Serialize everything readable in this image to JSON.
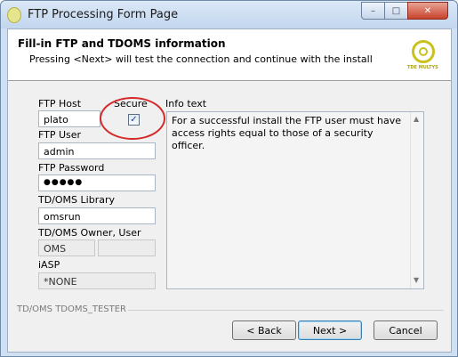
{
  "window": {
    "title": "FTP Processing Form Page",
    "min_symbol": "–",
    "max_symbol": "□",
    "close_symbol": "✕"
  },
  "header": {
    "title": "Fill-in FTP and TDOMS information",
    "subtitle": "Pressing <Next> will test the connection and continue with the install",
    "logo_text": "TDE MULTYS"
  },
  "form": {
    "ftp_host": {
      "label": "FTP Host",
      "value": "plato"
    },
    "secure": {
      "label": "Secure",
      "checked": true,
      "check_glyph": "✓"
    },
    "ftp_user": {
      "label": "FTP User",
      "value": "admin"
    },
    "ftp_password": {
      "label": "FTP Password",
      "value": "●●●●●"
    },
    "tdoms_library": {
      "label": "TD/OMS Library",
      "value": "omsrun"
    },
    "tdoms_owner": {
      "label": "TD/OMS Owner, User",
      "owner_value": "OMS",
      "user_value": ""
    },
    "iasp": {
      "label": "iASP",
      "value": "*NONE"
    }
  },
  "info": {
    "label": "Info text",
    "text": "For a successful install the FTP user must have access rights equal to those of a security officer.",
    "scroll_up": "▲",
    "scroll_down": "▼"
  },
  "footer": {
    "group_label": "TD/OMS TDOMS_TESTER",
    "back_label": "< Back",
    "next_label": "Next >",
    "cancel_label": "Cancel"
  },
  "colors": {
    "highlight": "#d42a2a",
    "logo": "#c9c21e"
  }
}
